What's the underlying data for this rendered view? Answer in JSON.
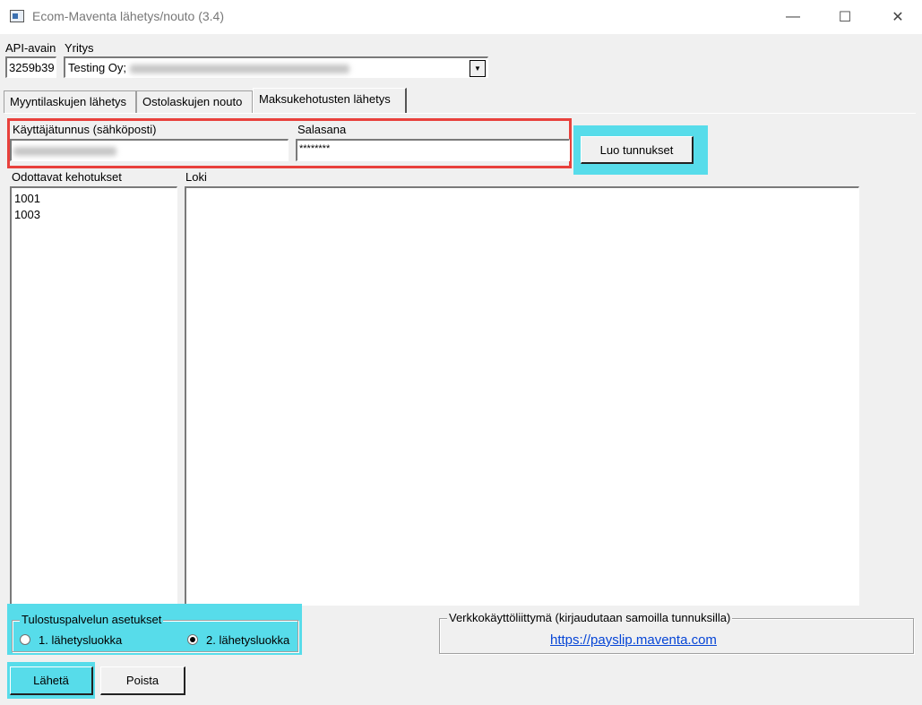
{
  "window": {
    "title": "Ecom-Maventa lähetys/nouto (3.4)",
    "min_glyph": "—",
    "max_glyph": "☐",
    "close_glyph": "✕",
    "icon": "app-window-icon"
  },
  "header": {
    "api_key_label": "API-avain",
    "api_key_value": "3259b39",
    "company_label": "Yritys",
    "company_value": "Testing Oy;",
    "dropdown_glyph": "▼"
  },
  "tabs": [
    {
      "label": "Myyntilaskujen lähetys"
    },
    {
      "label": "Ostolaskujen nouto"
    },
    {
      "label": "Maksukehotusten lähetys",
      "active": true
    }
  ],
  "credentials": {
    "username_label": "Käyttäjätunnus (sähköposti)",
    "password_label": "Salasana",
    "password_value": "********",
    "create_button": "Luo tunnukset"
  },
  "pending": {
    "label": "Odottavat kehotukset",
    "items": [
      "1001",
      "1003"
    ]
  },
  "log": {
    "label": "Loki"
  },
  "print_service": {
    "title": "Tulostuspalvelun asetukset",
    "options": [
      {
        "label": "1. lähetysluokka",
        "selected": false
      },
      {
        "label": "2. lähetysluokka",
        "selected": true
      }
    ]
  },
  "web_ui": {
    "title": "Verkkokäyttöliittymä (kirjaudutaan samoilla tunnuksilla)",
    "link": "https://payslip.maventa.com"
  },
  "actions": {
    "send": "Lähetä",
    "delete": "Poista"
  },
  "colors": {
    "highlight_cyan": "#57dcea",
    "highlight_red": "#e8413c",
    "link_blue": "#0645d6"
  }
}
